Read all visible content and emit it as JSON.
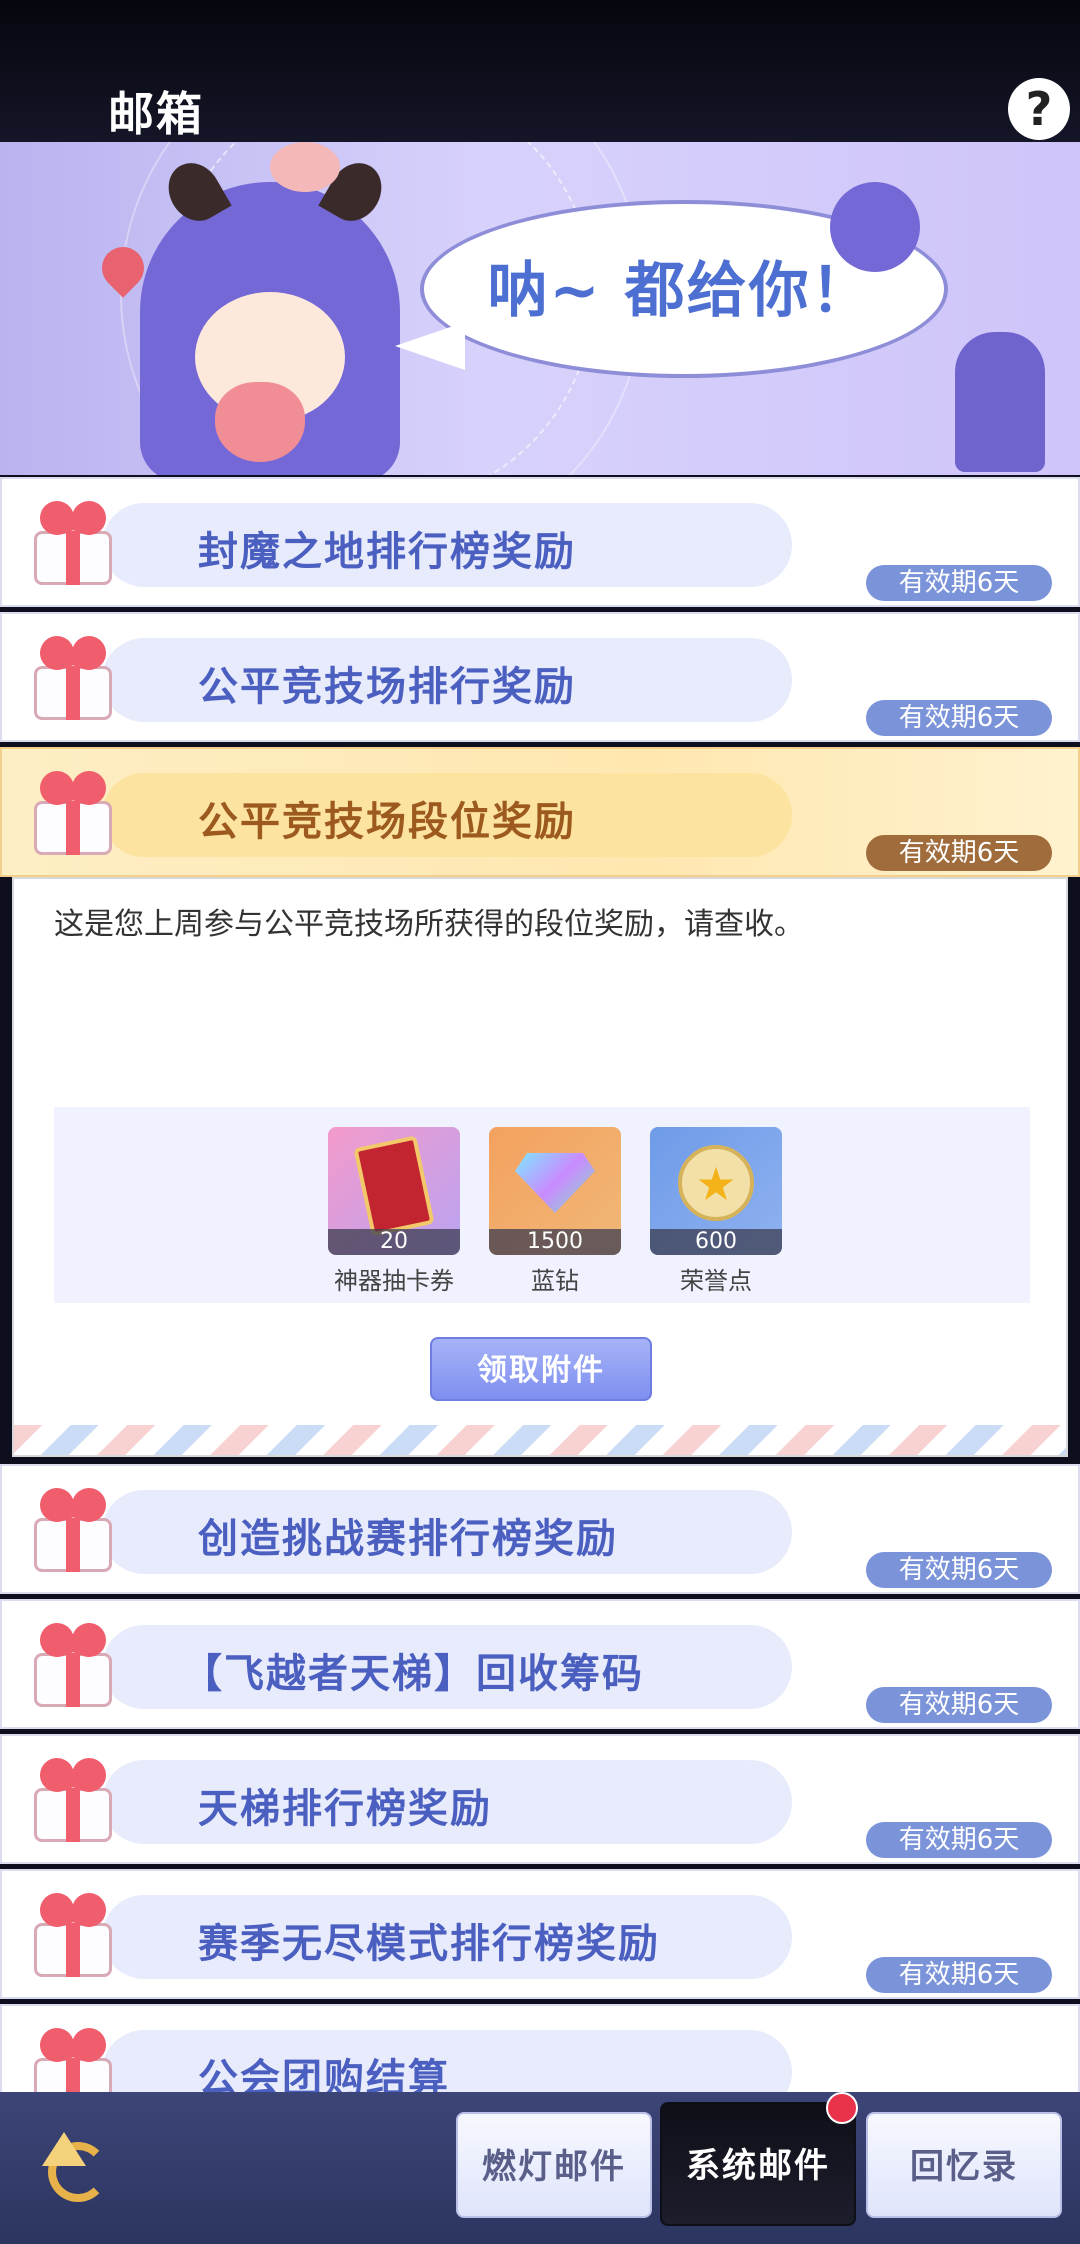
{
  "header": {
    "title": "邮箱",
    "help_icon": "?"
  },
  "banner": {
    "speech": "呐~ 都给你！"
  },
  "mails": [
    {
      "name": "封魔之地排行榜奖励",
      "expiry": "有效期6天"
    },
    {
      "name": "公平竞技场排行奖励",
      "expiry": "有效期6天"
    },
    {
      "name": "公平竞技场段位奖励",
      "expiry": "有效期6天"
    },
    {
      "name": "创造挑战赛排行榜奖励",
      "expiry": "有效期6天"
    },
    {
      "name": "【飞越者天梯】回收筹码",
      "expiry": "有效期6天"
    },
    {
      "name": "天梯排行榜奖励",
      "expiry": "有效期6天"
    },
    {
      "name": "赛季无尽模式排行榜奖励",
      "expiry": "有效期6天"
    },
    {
      "name": "公会团购结算",
      "expiry": ""
    }
  ],
  "detail": {
    "message": "这是您上周参与公平竞技场所获得的段位奖励，请查收。",
    "attachments": [
      {
        "label": "神器抽卡券",
        "qty": "20",
        "icon": "card-ticket-icon"
      },
      {
        "label": "蓝钻",
        "qty": "1500",
        "icon": "blue-diamond-icon"
      },
      {
        "label": "荣誉点",
        "qty": "600",
        "icon": "honor-star-icon"
      }
    ],
    "claim_label": "领取附件"
  },
  "tabs": [
    {
      "label": "燃灯邮件"
    },
    {
      "label": "系统邮件"
    },
    {
      "label": "回忆录"
    }
  ],
  "colors": {
    "accent": "#4a5fbf",
    "open_bg": "#ffe7b0",
    "badge": "#7b93d9",
    "notify": "#e8334a"
  }
}
